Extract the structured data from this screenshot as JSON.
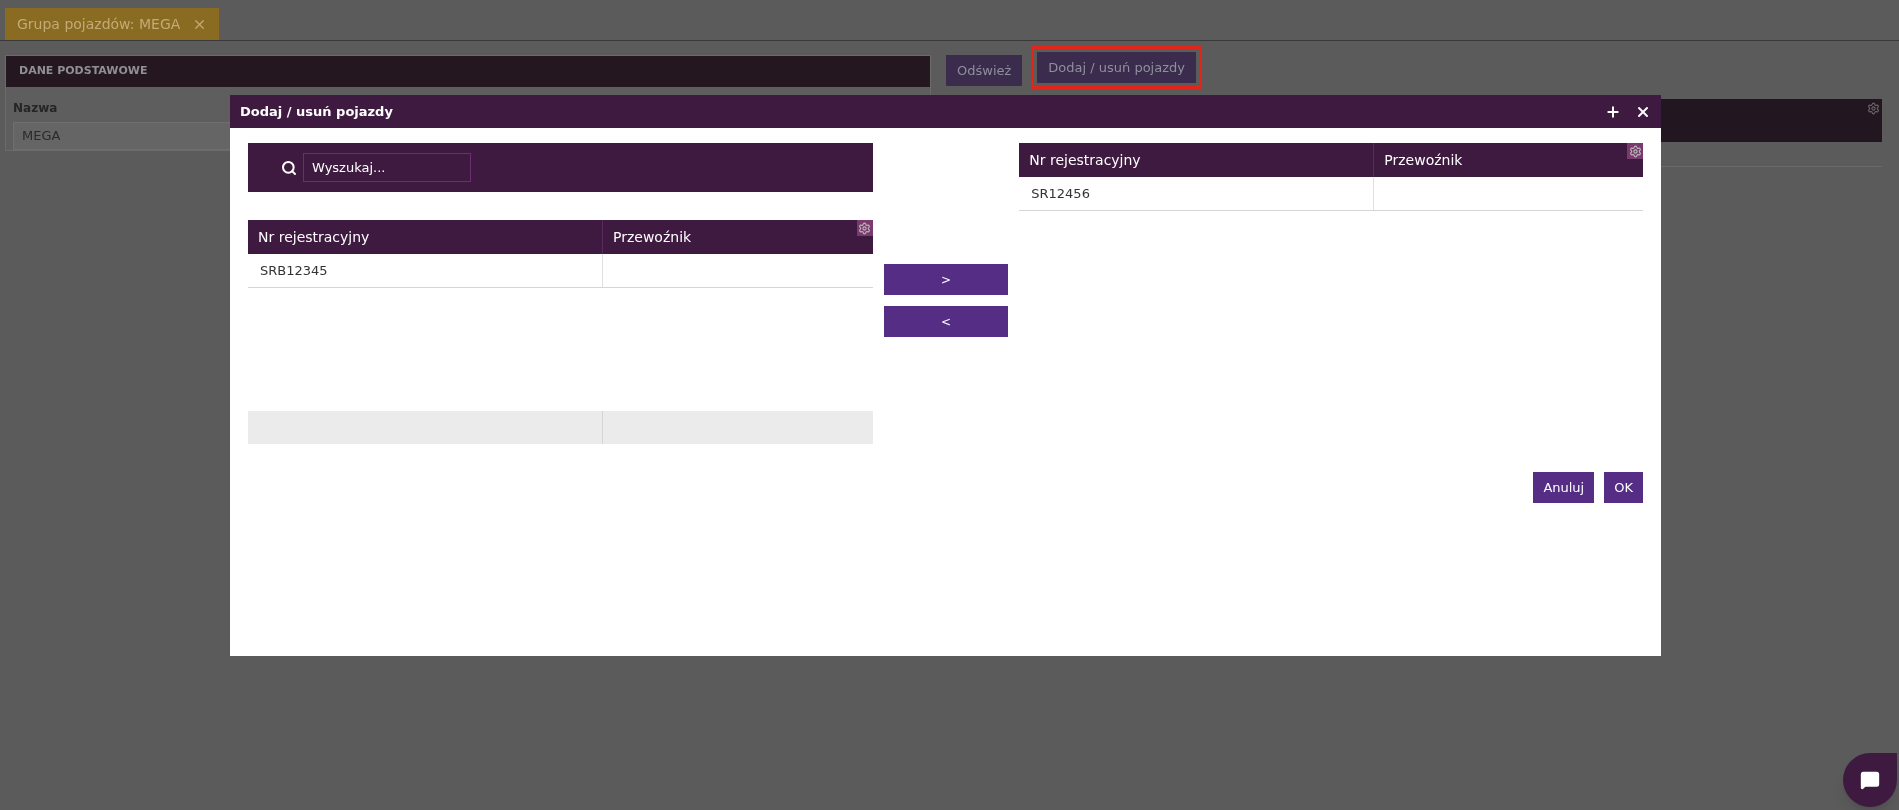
{
  "tab": {
    "label": "Grupa pojazdów: MEGA"
  },
  "panel": {
    "title": "DANE PODSTAWOWE",
    "field": {
      "label": "Nazwa",
      "value": "MEGA"
    }
  },
  "toolbar": [
    {
      "label": "Odśwież",
      "highlighted": false
    },
    {
      "label": "Dodaj / usuń pojazdy",
      "highlighted": true
    }
  ],
  "dialog": {
    "title": "Dodaj / usuń pojazdy",
    "search": {
      "placeholder": "Wyszukaj..."
    },
    "left_table": {
      "columns": [
        "Nr rejestracyjny",
        "Przewoźnik"
      ],
      "rows": [
        {
          "plate": "SRB12345"
        }
      ]
    },
    "transfer_buttons": [
      ">",
      "<"
    ],
    "right_table": {
      "columns": [
        "Nr rejestracyjny",
        "Przewoźnik"
      ],
      "rows": [
        {
          "plate": "SR12456"
        }
      ]
    },
    "actions": [
      "Anuluj",
      "OK"
    ]
  }
}
